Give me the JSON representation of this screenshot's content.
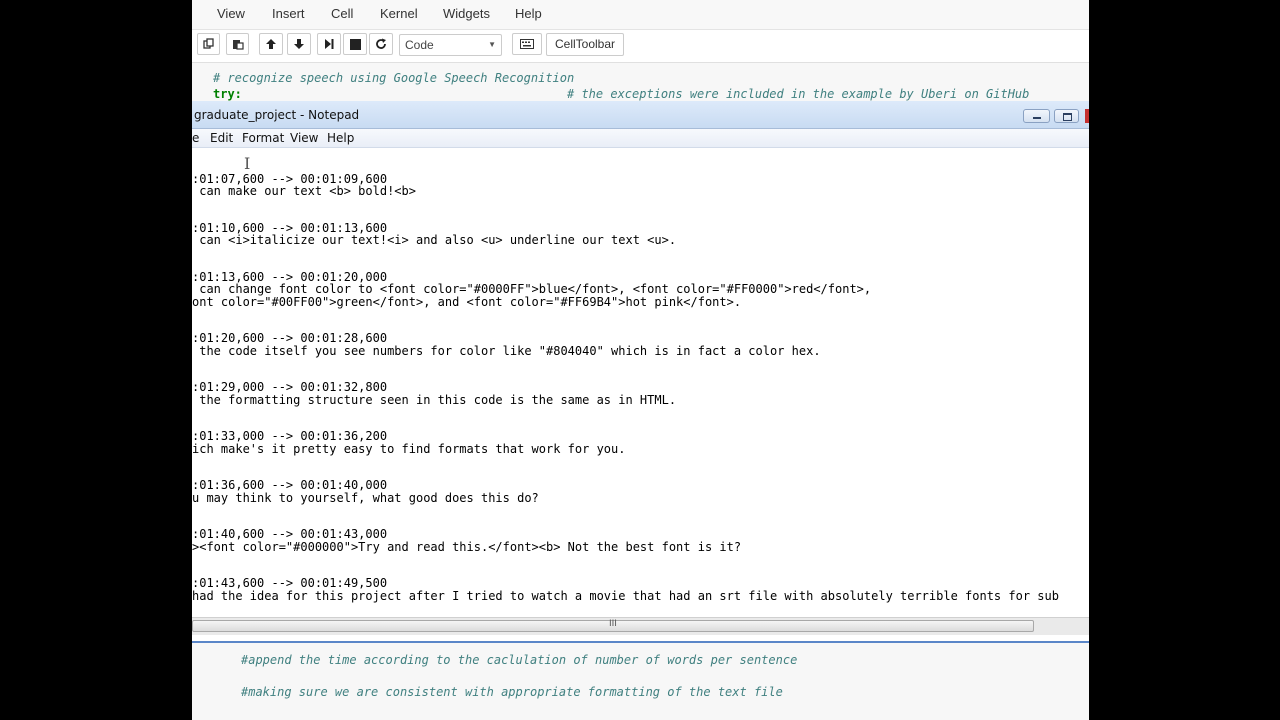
{
  "jupyter": {
    "menu": [
      "View",
      "Insert",
      "Cell",
      "Kernel",
      "Widgets",
      "Help"
    ],
    "cell_type": "Code",
    "celltoolbar_label": "CellToolbar",
    "top_cell": {
      "comment1": "# recognize speech using Google Speech Recognition",
      "keyword": "try:",
      "comment2": "# the exceptions were included in the example by Uberi on GitHub"
    },
    "bottom_cell": {
      "comment1": "#append the time according to the caclulation of number of words per sentence",
      "comment2": "#making sure we are consistent with appropriate formatting of the text file"
    }
  },
  "notepad": {
    "title": "graduate_project - Notepad",
    "menu": [
      "e",
      "Edit",
      "Format",
      "View",
      "Help"
    ],
    "lines": [
      ":01:07,600 --> 00:01:09,600",
      " can make our text <b> bold!<b>",
      "",
      "",
      ":01:10,600 --> 00:01:13,600",
      " can <i>italicize our text!<i> and also <u> underline our text <u>.",
      "",
      "",
      ":01:13,600 --> 00:01:20,000",
      " can change font color to <font color=\"#0000FF\">blue</font>, <font color=\"#FF0000\">red</font>,",
      "ont color=\"#00FF00\">green</font>, and <font color=\"#FF69B4\">hot pink</font>.",
      "",
      "",
      ":01:20,600 --> 00:01:28,600",
      " the code itself you see numbers for color like \"#804040\" which is in fact a color hex.",
      "",
      "",
      ":01:29,000 --> 00:01:32,800",
      " the formatting structure seen in this code is the same as in HTML.",
      "",
      "",
      ":01:33,000 --> 00:01:36,200",
      "ich make's it pretty easy to find formats that work for you.",
      "",
      "",
      ":01:36,600 --> 00:01:40,000",
      "u may think to yourself, what good does this do?",
      "",
      "",
      ":01:40,600 --> 00:01:43,000",
      "><font color=\"#000000\">Try and read this.</font><b> Not the best font is it?",
      "",
      "",
      ":01:43,600 --> 00:01:49,500",
      "had the idea for this project after I tried to watch a movie that had an srt file with absolutely terrible fonts for sub"
    ]
  }
}
